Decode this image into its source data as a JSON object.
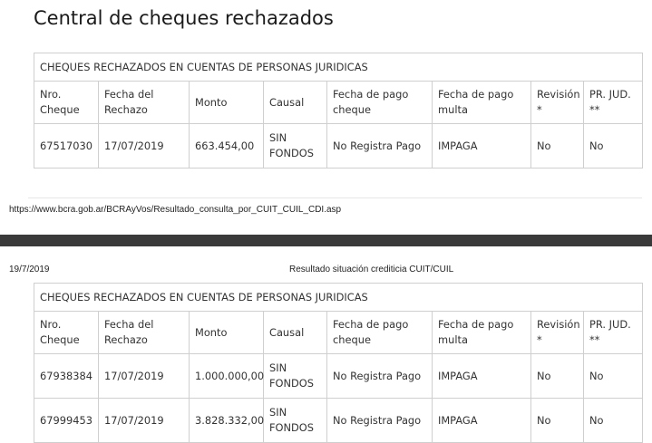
{
  "page1": {
    "title": "Central de cheques rechazados",
    "table_caption": "CHEQUES RECHAZADOS EN CUENTAS DE PERSONAS JURIDICAS",
    "headers": [
      [
        "Nro.",
        "Cheque"
      ],
      [
        "Fecha del",
        "Rechazo"
      ],
      [
        "Monto"
      ],
      [
        "Causal"
      ],
      [
        "Fecha de pago",
        "cheque"
      ],
      [
        "Fecha de pago",
        "multa"
      ],
      [
        "Revisión",
        "*"
      ],
      [
        "PR. JUD.",
        "**"
      ]
    ],
    "rows": [
      {
        "nro": "67517030",
        "fecha": "17/07/2019",
        "monto": "663.454,00",
        "causal": [
          "SIN",
          "FONDOS"
        ],
        "pago_cheque": "No Registra Pago",
        "pago_multa": "IMPAGA",
        "revision": "No",
        "pr_jud": "No"
      }
    ],
    "footer_url": "https://www.bcra.gob.ar/BCRAyVos/Resultado_consulta_por_CUIT_CUIL_CDI.asp"
  },
  "page2": {
    "date": "19/7/2019",
    "header_title": "Resultado situación crediticia CUIT/CUIL",
    "table_caption": "CHEQUES RECHAZADOS EN CUENTAS DE PERSONAS JURIDICAS",
    "headers": [
      [
        "Nro.",
        "Cheque"
      ],
      [
        "Fecha del",
        "Rechazo"
      ],
      [
        "Monto"
      ],
      [
        "Causal"
      ],
      [
        "Fecha de pago",
        "cheque"
      ],
      [
        "Fecha de pago",
        "multa"
      ],
      [
        "Revisión",
        "*"
      ],
      [
        "PR. JUD.",
        "**"
      ]
    ],
    "rows": [
      {
        "nro": "67938384",
        "fecha": "17/07/2019",
        "monto": "1.000.000,00",
        "causal": [
          "SIN",
          "FONDOS"
        ],
        "pago_cheque": "No Registra Pago",
        "pago_multa": "IMPAGA",
        "revision": "No",
        "pr_jud": "No"
      },
      {
        "nro": "67999453",
        "fecha": "17/07/2019",
        "monto": "3.828.332,00",
        "causal": [
          "SIN",
          "FONDOS"
        ],
        "pago_cheque": "No Registra Pago",
        "pago_multa": "IMPAGA",
        "revision": "No",
        "pr_jud": "No"
      }
    ]
  }
}
